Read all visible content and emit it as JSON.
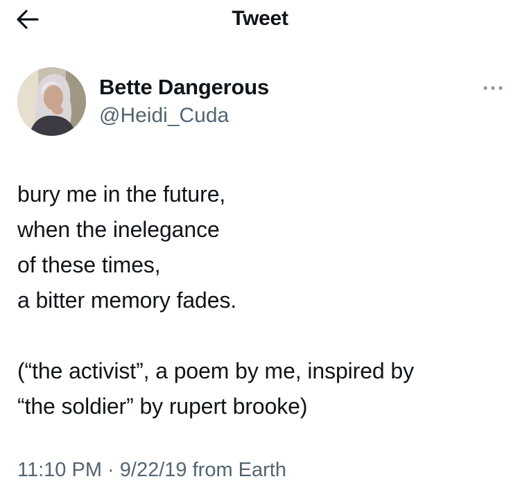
{
  "header": {
    "title": "Tweet",
    "back_icon": "arrow-left-icon"
  },
  "author": {
    "display_name": "Bette Dangerous",
    "handle": "@Heidi_Cuda",
    "avatar_icon": "profile-photo",
    "more_icon": "more-dots-icon"
  },
  "tweet": {
    "lines": [
      "bury me in the future,",
      "when the inelegance",
      "of these times,",
      "a bitter memory fades.",
      "",
      "(“the activist”, a poem by me, inspired by",
      "“the soldier” by rupert brooke)"
    ],
    "time": "11:10 PM",
    "separator": "·",
    "date": "9/22/19",
    "source": "from Earth"
  },
  "colors": {
    "text": "#0f1419",
    "secondary": "#536471",
    "background": "#ffffff"
  }
}
